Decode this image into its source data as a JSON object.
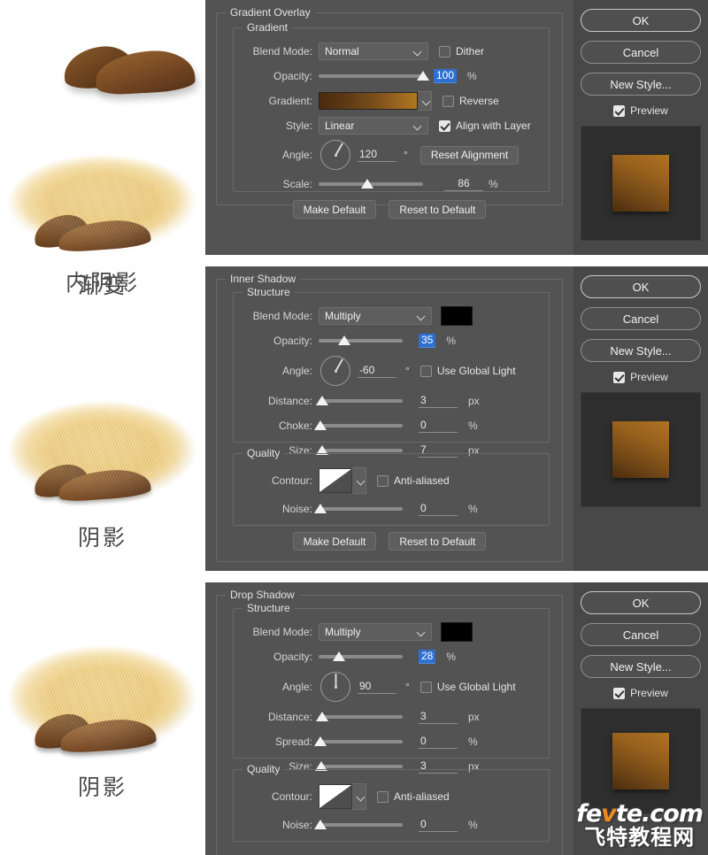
{
  "illustrations": [
    {
      "caption": "渐变",
      "name": "gradient-example"
    },
    {
      "caption": "内阴影",
      "name": "inner-shadow-example"
    },
    {
      "caption": "阴影",
      "name": "drop-shadow-example"
    }
  ],
  "dialogs": [
    {
      "title": "Gradient Overlay",
      "section": "Gradient",
      "rows": {
        "blend_mode_label": "Blend Mode:",
        "blend_mode_value": "Normal",
        "dither_label": "Dither",
        "dither_checked": false,
        "opacity_label": "Opacity:",
        "opacity_value": "100",
        "opacity_unit": "%",
        "gradient_label": "Gradient:",
        "reverse_label": "Reverse",
        "reverse_checked": false,
        "style_label": "Style:",
        "style_value": "Linear",
        "align_label": "Align with Layer",
        "align_checked": true,
        "angle_label": "Angle:",
        "angle_value": "120",
        "angle_unit": "°",
        "reset_alignment_label": "Reset Alignment",
        "scale_label": "Scale:",
        "scale_value": "86",
        "scale_unit": "%"
      },
      "footer": {
        "make_default": "Make Default",
        "reset_to_default": "Reset to Default"
      },
      "buttons": {
        "ok": "OK",
        "cancel": "Cancel",
        "new_style": "New Style...",
        "preview": "Preview",
        "preview_checked": true
      }
    },
    {
      "title": "Inner Shadow",
      "section": "Structure",
      "quality_section": "Quality",
      "rows": {
        "blend_mode_label": "Blend Mode:",
        "blend_mode_value": "Multiply",
        "color_swatch": "#000000",
        "opacity_label": "Opacity:",
        "opacity_value": "35",
        "opacity_unit": "%",
        "angle_label": "Angle:",
        "angle_value": "-60",
        "angle_unit": "°",
        "use_global_light_label": "Use Global Light",
        "use_global_light_checked": false,
        "distance_label": "Distance:",
        "distance_value": "3",
        "distance_unit": "px",
        "choke_label": "Choke:",
        "choke_value": "0",
        "choke_unit": "%",
        "size_label": "Size:",
        "size_value": "7",
        "size_unit": "px",
        "contour_label": "Contour:",
        "anti_aliased_label": "Anti-aliased",
        "anti_aliased_checked": false,
        "noise_label": "Noise:",
        "noise_value": "0",
        "noise_unit": "%"
      },
      "footer": {
        "make_default": "Make Default",
        "reset_to_default": "Reset to Default"
      },
      "buttons": {
        "ok": "OK",
        "cancel": "Cancel",
        "new_style": "New Style...",
        "preview": "Preview",
        "preview_checked": true
      }
    },
    {
      "title": "Drop Shadow",
      "section": "Structure",
      "quality_section": "Quality",
      "rows": {
        "blend_mode_label": "Blend Mode:",
        "blend_mode_value": "Multiply",
        "color_swatch": "#000000",
        "opacity_label": "Opacity:",
        "opacity_value": "28",
        "opacity_unit": "%",
        "angle_label": "Angle:",
        "angle_value": "90",
        "angle_unit": "°",
        "use_global_light_label": "Use Global Light",
        "use_global_light_checked": false,
        "distance_label": "Distance:",
        "distance_value": "3",
        "distance_unit": "px",
        "spread_label": "Spread:",
        "spread_value": "0",
        "spread_unit": "%",
        "size_label": "Size:",
        "size_value": "3",
        "size_unit": "px",
        "contour_label": "Contour:",
        "anti_aliased_label": "Anti-aliased",
        "anti_aliased_checked": false,
        "noise_label": "Noise:",
        "noise_value": "0",
        "noise_unit": "%"
      },
      "buttons": {
        "ok": "OK",
        "cancel": "Cancel",
        "new_style": "New Style...",
        "preview": "Preview",
        "preview_checked": true
      }
    }
  ],
  "watermark": {
    "line1_a": "fe",
    "line1_v": "v",
    "line1_b": "te.com",
    "line2": "飞特教程网"
  }
}
